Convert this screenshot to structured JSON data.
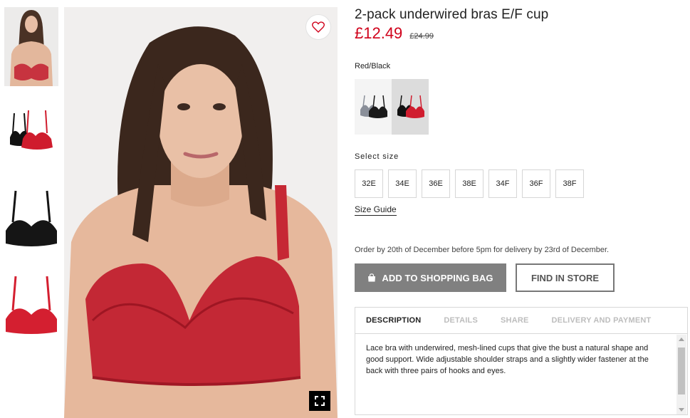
{
  "product": {
    "title": "2-pack underwired bras E/F cup",
    "price": "£12.49",
    "old_price": "£24.99",
    "color_name": "Red/Black",
    "accent_color": "#d0021b"
  },
  "sizes": {
    "label": "Select size",
    "options": [
      "32E",
      "34E",
      "36E",
      "38E",
      "34F",
      "36F",
      "38F"
    ],
    "guide_label": "Size Guide"
  },
  "delivery": {
    "note": "Order by 20th of December before 5pm for delivery by 23rd of December."
  },
  "actions": {
    "add_to_bag": "ADD TO SHOPPING BAG",
    "find_in_store": "FIND IN STORE"
  },
  "tabs": {
    "items": [
      "DESCRIPTION",
      "DETAILS",
      "SHARE",
      "DELIVERY AND PAYMENT"
    ],
    "active": "DESCRIPTION"
  },
  "description": "Lace bra with underwired, mesh-lined cups that give the bust a natural shape and good support. Wide adjustable shoulder straps and a slightly wider fastener at the back with three pairs of hooks and eyes.",
  "icons": {
    "favorite": "heart-icon",
    "zoom": "fullscreen-icon",
    "bag": "shopping-bag-icon"
  }
}
